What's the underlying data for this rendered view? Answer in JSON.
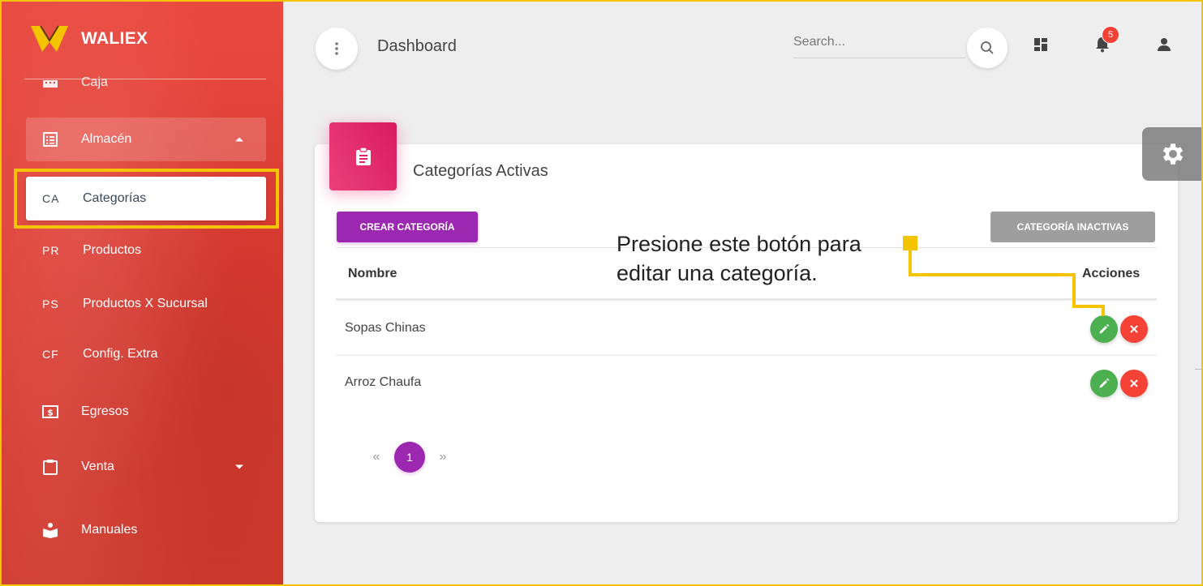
{
  "brand": {
    "name": "WALIEX"
  },
  "sidebar": {
    "items": [
      {
        "label": "Caja",
        "icon": "cash-register-icon"
      },
      {
        "label": "Almacén",
        "icon": "list-box-icon",
        "expanded": true
      },
      {
        "abbr": "CA",
        "label": "Categorías",
        "active": true
      },
      {
        "abbr": "PR",
        "label": "Productos"
      },
      {
        "abbr": "PS",
        "label": "Productos X Sucursal"
      },
      {
        "abbr": "CF",
        "label": "Config. Extra"
      },
      {
        "label": "Egresos",
        "icon": "money-icon"
      },
      {
        "label": "Venta",
        "icon": "clipboard-icon",
        "expanded": false
      },
      {
        "label": "Manuales",
        "icon": "reading-icon"
      }
    ]
  },
  "header": {
    "title": "Dashboard",
    "search_placeholder": "Search...",
    "notification_count": "5"
  },
  "card": {
    "title": "Categorías Activas",
    "create_button": "CREAR CATEGORÍA",
    "inactive_button": "CATEGORÍA INACTIVAS",
    "columns": [
      "Nombre",
      "Acciones"
    ],
    "rows": [
      "Sopas Chinas",
      "Arroz Chaufa"
    ],
    "pagination": {
      "prev": "«",
      "current": "1",
      "next": "»"
    }
  },
  "annotation": {
    "line1": "Presione este botón para",
    "line2": "editar una categoría."
  },
  "colors": {
    "sidebar": "#e9493f",
    "primary": "#9c27b0",
    "edit": "#4caf50",
    "delete": "#f44336",
    "highlight": "#f5c400",
    "card_icon": "#e91e63"
  }
}
